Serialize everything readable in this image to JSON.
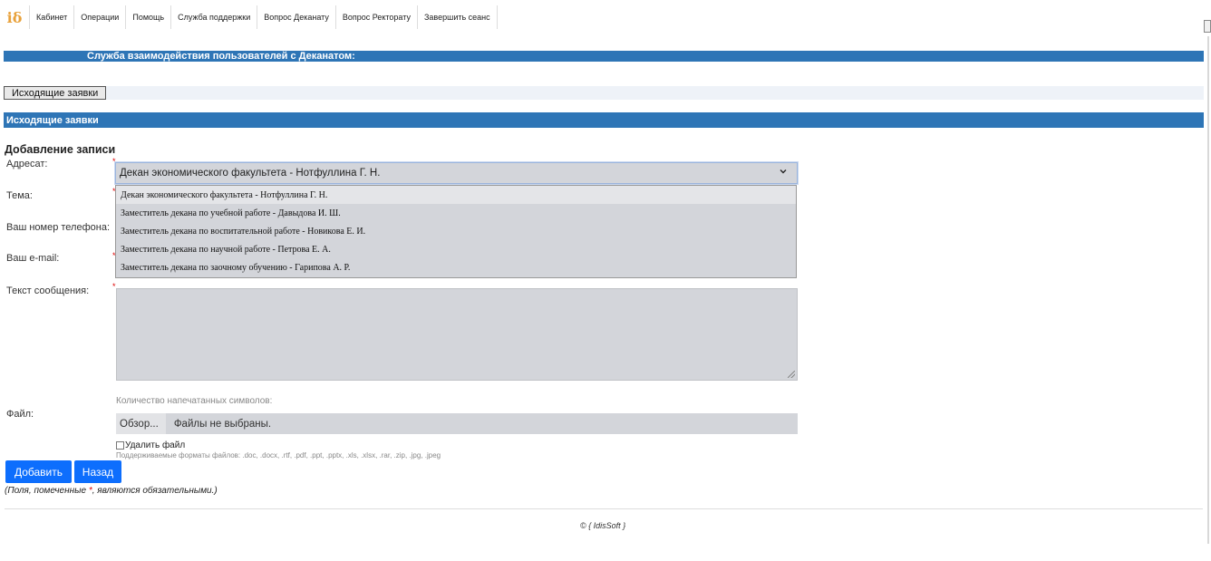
{
  "nav": {
    "logo": "iδ",
    "items": [
      "Кабинет",
      "Операции",
      "Помощь",
      "Служба поддержки",
      "Вопрос Деканату",
      "Вопрос Ректорату",
      "Завершить сеанс"
    ]
  },
  "header": {
    "title": "Служба взаимодействия пользователей с Деканатом:"
  },
  "tabs": {
    "outgoing": "Исходящие заявки"
  },
  "section": {
    "title": "Исходящие заявки"
  },
  "form": {
    "title": "Добавление записи",
    "required_mark": "*",
    "labels": {
      "addressee": "Адресат:",
      "subject": "Тема:",
      "phone": "Ваш номер телефона:",
      "email": "Ваш e-mail:",
      "message": "Текст сообщения:",
      "file": "Файл:"
    },
    "addressee_selected": "Декан экономического факультета - Нотфуллина Г. Н.",
    "addressee_options": [
      "Декан экономического факультета - Нотфуллина Г. Н.",
      "Заместитель декана по учебной работе - Давыдова И. Ш.",
      "Заместитель декана по воспитательной работе - Новикова Е. И.",
      "Заместитель декана по научной работе - Петрова Е. А.",
      "Заместитель декана по заочному обучению - Гарипова А. Р."
    ],
    "char_count_label": "Количество напечатанных символов:",
    "file_browse": "Обзор...",
    "file_status": "Файлы не выбраны.",
    "delete_file": "Удалить файл",
    "formats": "Поддерживаемые форматы файлов: .doc, .docx, .rtf, .pdf, .ppt, .pptx, .xls, .xlsx, .rar, .zip, .jpg, .jpeg",
    "submit": "Добавить",
    "back": "Назад",
    "note_prefix": "(Поля, помеченные ",
    "note_star": "*",
    "note_suffix": ", являются обязательными.)"
  },
  "footer": {
    "copyright": "© { IdisSoft }"
  },
  "colors": {
    "accent": "#2e75b6",
    "button": "#0d6efd",
    "required": "#dd0000"
  }
}
